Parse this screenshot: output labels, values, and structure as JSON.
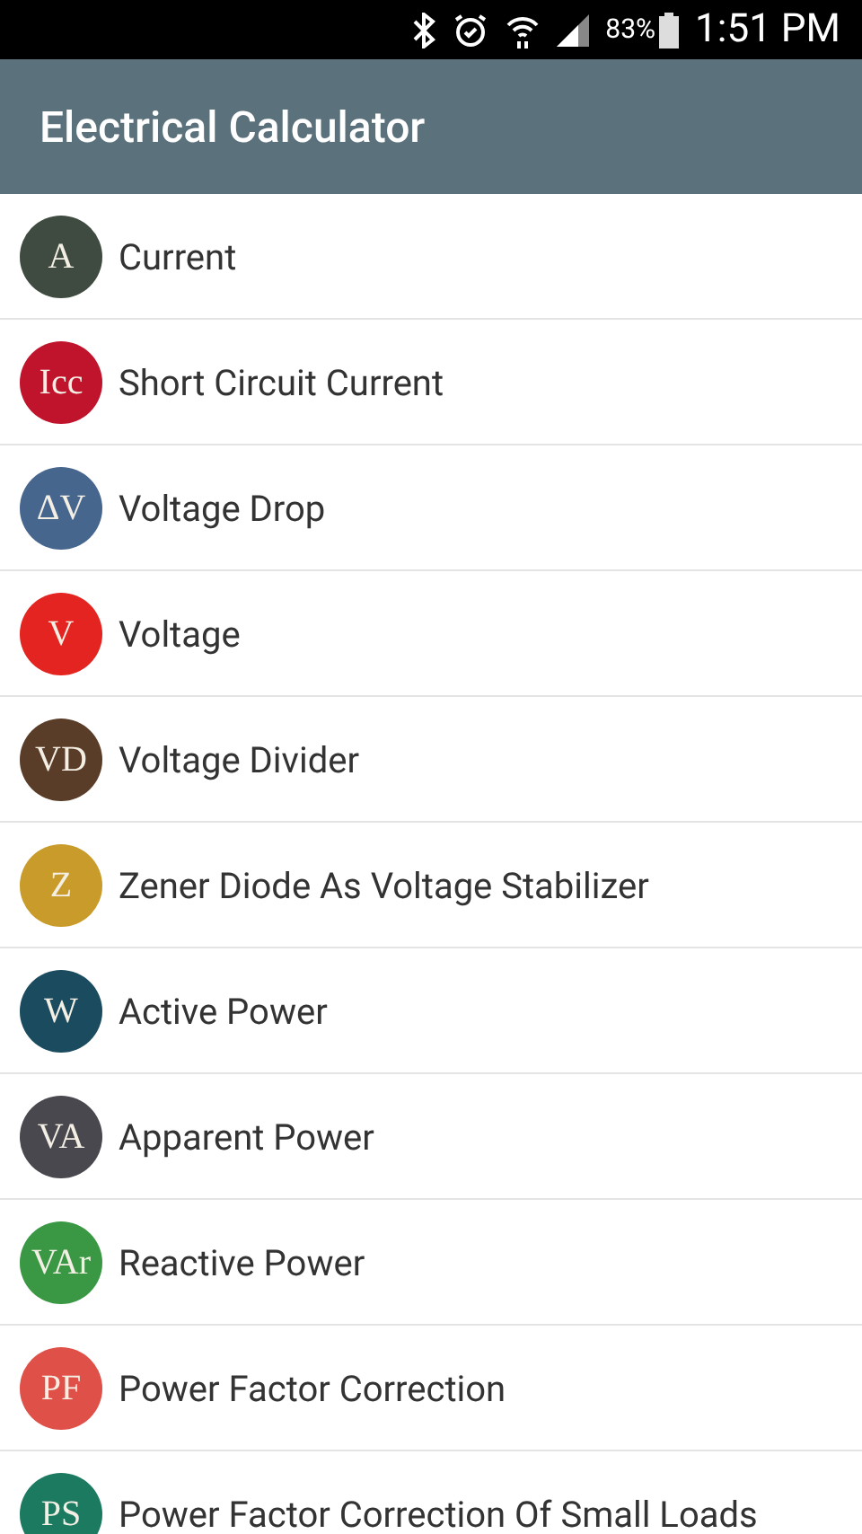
{
  "status_bar": {
    "battery": "83%",
    "time": "1:51 PM"
  },
  "app_bar": {
    "title": "Electrical Calculator"
  },
  "items": [
    {
      "symbol": "A",
      "label": "Current",
      "color": "#3f4b40"
    },
    {
      "symbol": "Icc",
      "label": "Short Circuit Current",
      "color": "#c0142c"
    },
    {
      "symbol": "ΔV",
      "label": "Voltage Drop",
      "color": "#47668e"
    },
    {
      "symbol": "V",
      "label": "Voltage",
      "color": "#e42420"
    },
    {
      "symbol": "VD",
      "label": "Voltage Divider",
      "color": "#5a3d29"
    },
    {
      "symbol": "Z",
      "label": "Zener Diode As Voltage Stabilizer",
      "color": "#c89b2a"
    },
    {
      "symbol": "W",
      "label": "Active Power",
      "color": "#1b4b5e"
    },
    {
      "symbol": "VA",
      "label": "Apparent Power",
      "color": "#48484e"
    },
    {
      "symbol": "VAr",
      "label": "Reactive Power",
      "color": "#3a9844"
    },
    {
      "symbol": "PF",
      "label": "Power Factor Correction",
      "color": "#df5048"
    },
    {
      "symbol": "PS",
      "label": "Power Factor Correction Of Small Loads",
      "color": "#1b7a60"
    }
  ]
}
